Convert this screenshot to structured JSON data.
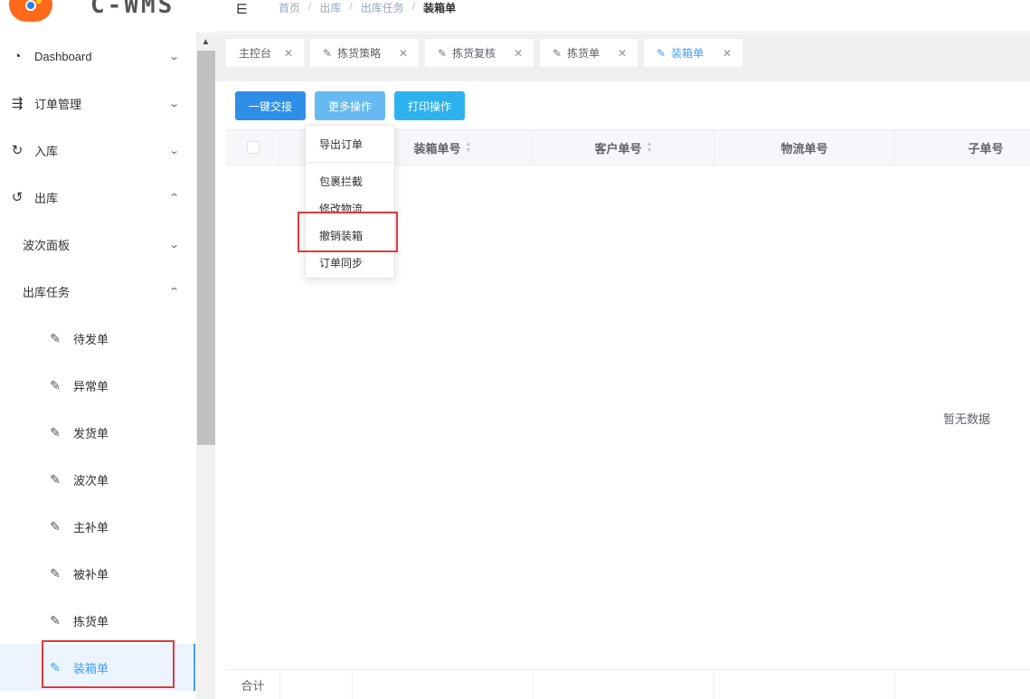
{
  "brand": {
    "logo_text": "C-WMS"
  },
  "header": {
    "breadcrumb": [
      "首页",
      "出库",
      "出库任务",
      "装箱单"
    ]
  },
  "sidebar": {
    "items": [
      {
        "label": "Dashboard",
        "icon": "dashboard-icon",
        "expanded": false
      },
      {
        "label": "订单管理",
        "icon": "order-icon",
        "expanded": false
      },
      {
        "label": "入库",
        "icon": "inbound-icon",
        "expanded": false
      },
      {
        "label": "出库",
        "icon": "outbound-icon",
        "expanded": true
      }
    ],
    "sub_items": [
      {
        "label": "波次面板",
        "expanded": false
      },
      {
        "label": "出库任务",
        "expanded": true
      }
    ],
    "leaf_items": [
      {
        "label": "待发单",
        "icon": "edit-doc-icon"
      },
      {
        "label": "异常单",
        "icon": "edit-doc-icon"
      },
      {
        "label": "发货单",
        "icon": "edit-doc-icon"
      },
      {
        "label": "波次单",
        "icon": "edit-doc-icon"
      },
      {
        "label": "主补单",
        "icon": "edit-doc-icon"
      },
      {
        "label": "被补单",
        "icon": "edit-doc-icon"
      },
      {
        "label": "拣货单",
        "icon": "edit-doc-icon"
      },
      {
        "label": "装箱单",
        "icon": "edit-doc-icon",
        "active": true
      }
    ]
  },
  "tabs": [
    {
      "label": "主控台",
      "icon": "",
      "active": false
    },
    {
      "label": "拣货策略",
      "icon": "edit-doc-icon",
      "active": false
    },
    {
      "label": "拣货复核",
      "icon": "edit-doc-icon",
      "active": false
    },
    {
      "label": "拣货单",
      "icon": "edit-doc-icon",
      "active": false
    },
    {
      "label": "装箱单",
      "icon": "edit-doc-icon",
      "active": true
    }
  ],
  "toolbar": {
    "handover_label": "一键交接",
    "more_label": "更多操作",
    "print_label": "打印操作"
  },
  "dropdown": {
    "items": [
      "导出订单",
      "包裹拦截",
      "修改物流",
      "撤销装箱",
      "订单同步"
    ],
    "highlighted": "撤销装箱"
  },
  "table": {
    "columns": [
      "",
      "",
      "装箱单号",
      "客户单号",
      "物流单号",
      "子单号"
    ],
    "empty_text": "暂无数据",
    "footer_label": "合计"
  },
  "colors": {
    "primary": "#409eff",
    "brand_orange": "#ff6a1a",
    "highlight_box": "#e03a3a"
  }
}
